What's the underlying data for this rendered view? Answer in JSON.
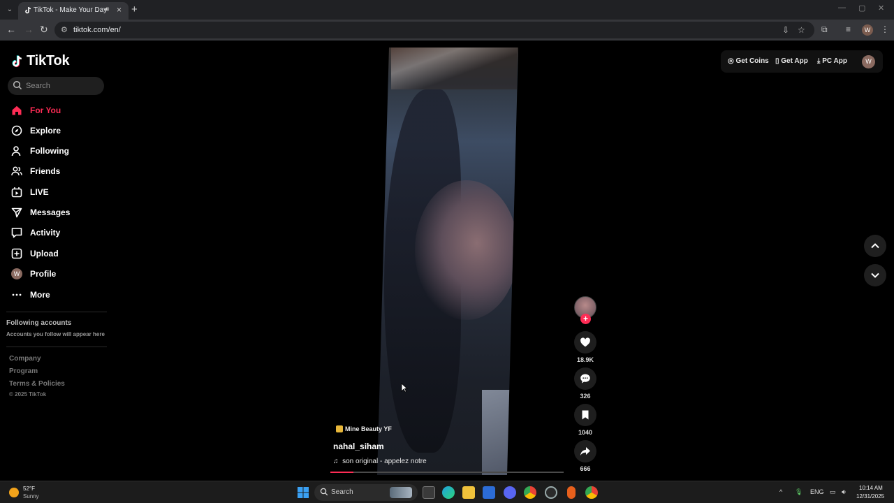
{
  "browser": {
    "tab_title": "TikTok - Make Your Day",
    "url": "tiktok.com/en/",
    "profile_initial": "W"
  },
  "sidebar": {
    "logo_text": "TikTok",
    "search_placeholder": "Search",
    "nav": [
      {
        "label": "For You",
        "icon": "home-icon",
        "active": true
      },
      {
        "label": "Explore",
        "icon": "compass-icon"
      },
      {
        "label": "Following",
        "icon": "person-icon"
      },
      {
        "label": "Friends",
        "icon": "friends-icon"
      },
      {
        "label": "LIVE",
        "icon": "live-icon"
      },
      {
        "label": "Messages",
        "icon": "send-icon"
      },
      {
        "label": "Activity",
        "icon": "activity-icon"
      },
      {
        "label": "Upload",
        "icon": "upload-icon"
      },
      {
        "label": "Profile",
        "icon": "avatar"
      },
      {
        "label": "More",
        "icon": "more-icon"
      }
    ],
    "profile_initial": "W",
    "following_title": "Following accounts",
    "following_sub": "Accounts you follow will appear here",
    "footer": [
      "Company",
      "Program",
      "Terms & Policies"
    ],
    "copyright": "© 2025 TikTok"
  },
  "header": {
    "get_coins": "Get Coins",
    "get_app": "Get App",
    "pc_app": "PC App",
    "avatar_initial": "W"
  },
  "video": {
    "badge": "Mine Beauty YF",
    "author": "nahal_siham",
    "music": "son original - appelez notre",
    "progress": 0.1,
    "likes": "18.9K",
    "comments": "326",
    "saves": "1040",
    "shares": "666"
  },
  "taskbar": {
    "temp": "52°F",
    "condition": "Sunny",
    "search_label": "Search",
    "lang": "ENG",
    "time": "10:14 AM",
    "date": "12/31/2025"
  },
  "colors": {
    "accent": "#fe2c55",
    "background": "#000000"
  }
}
